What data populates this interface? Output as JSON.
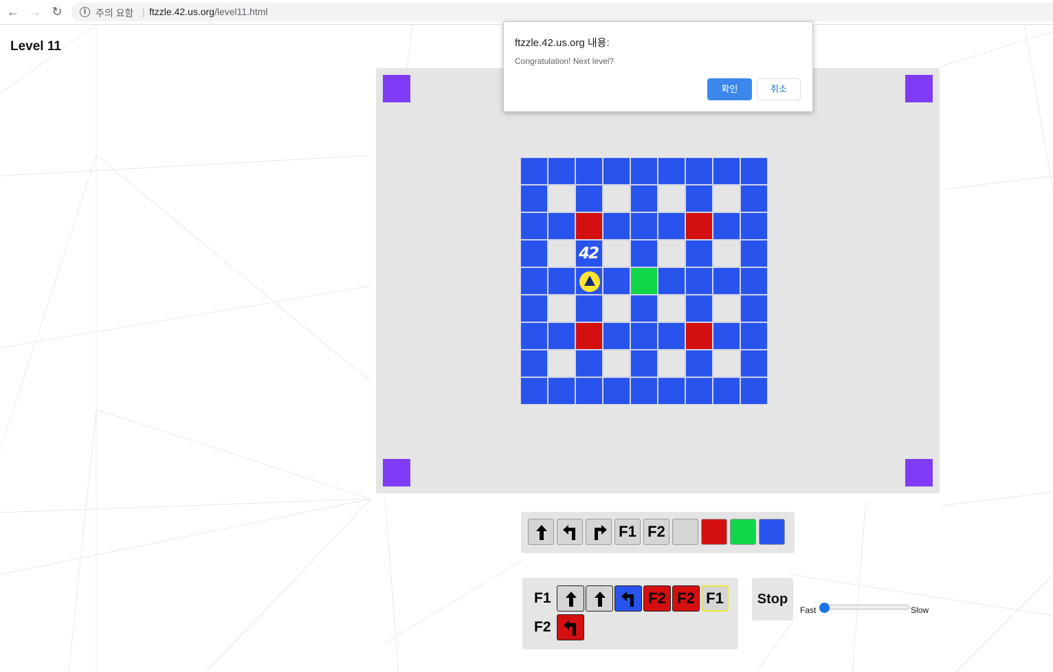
{
  "browser": {
    "security_label": "주의 요함",
    "url_host": "ftzzle.42.us.org",
    "url_path": "/level11.html"
  },
  "page": {
    "level_title": "Level 11"
  },
  "colors": {
    "board_blue": "#2853ec",
    "board_red": "#d40f0f",
    "board_green": "#11d64a",
    "board_gray": "#e5e5e5",
    "corner_purple": "#7f3bf5",
    "robot_yellow": "#ffe633"
  },
  "board": {
    "rows": [
      "bbbbbbbbb",
      "bwbwbwbwb",
      "bbrbbbrbb",
      "bwswbwbwb",
      "bbpbgbbbb",
      "bwbwbwbwb",
      "bbrbbbrbb",
      "bwbwbwbwb",
      "bbbbbbbbb"
    ],
    "legend": {
      "b": "blue",
      "w": "gray",
      "r": "red",
      "g": "green",
      "s": "42-star",
      "p": "robot-facing-up"
    },
    "star_label": "42"
  },
  "toolbox": {
    "items": [
      {
        "name": "forward",
        "icon": "arrow-up-icon"
      },
      {
        "name": "turn-left",
        "icon": "turn-left-icon"
      },
      {
        "name": "turn-right",
        "icon": "turn-right-icon"
      },
      {
        "name": "f1",
        "label": "F1"
      },
      {
        "name": "f2",
        "label": "F2"
      },
      {
        "name": "color-none",
        "color": "#d5d5d5"
      },
      {
        "name": "color-red",
        "color": "#d40f0f"
      },
      {
        "name": "color-green",
        "color": "#11d64a"
      },
      {
        "name": "color-blue",
        "color": "#2853ec"
      }
    ]
  },
  "program": {
    "f1_label": "F1",
    "f2_label": "F2",
    "f1": [
      {
        "icon": "arrow-up-icon",
        "color": "none"
      },
      {
        "icon": "arrow-up-icon",
        "color": "none"
      },
      {
        "icon": "turn-left-icon",
        "color": "blue"
      },
      {
        "label": "F2",
        "color": "red"
      },
      {
        "label": "F2",
        "color": "red"
      },
      {
        "label": "F1",
        "color": "none",
        "active": true
      }
    ],
    "f2": [
      {
        "icon": "turn-left-icon",
        "color": "red"
      }
    ]
  },
  "controls": {
    "stop_label": "Stop",
    "speed_fast": "Fast",
    "speed_slow": "Slow",
    "speed_value": 0
  },
  "dialog": {
    "title": "ftzzle.42.us.org 내용:",
    "message": "Congratulation! Next level?",
    "ok_label": "확인",
    "cancel_label": "취소"
  },
  "slot_text": {
    "f1_slot4": "F2",
    "f1_slot5": "F2",
    "f1_slot6": "F1",
    "tool_f1": "F1",
    "tool_f2": "F2"
  }
}
